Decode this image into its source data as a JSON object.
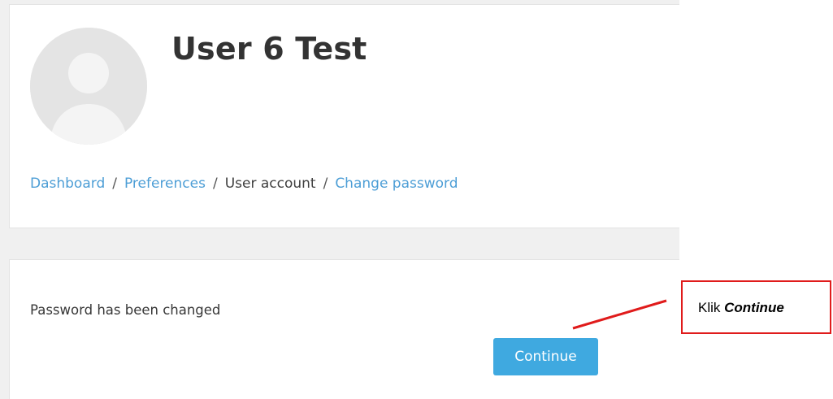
{
  "profile": {
    "name": "User 6 Test"
  },
  "breadcrumb": {
    "items": [
      {
        "label": "Dashboard",
        "link": true
      },
      {
        "label": "Preferences",
        "link": true
      },
      {
        "label": "User account",
        "link": false
      },
      {
        "label": "Change password",
        "link": true
      }
    ],
    "separator": "/"
  },
  "main": {
    "message": "Password has been changed",
    "continue_label": "Continue"
  },
  "annotation": {
    "prefix": "Klik ",
    "emphasis": "Continue"
  },
  "colors": {
    "link": "#4d9ed6",
    "button": "#3fa9e0",
    "callout": "#e01b1b"
  }
}
